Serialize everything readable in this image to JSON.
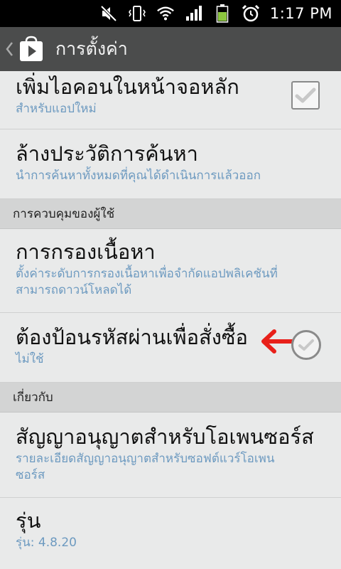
{
  "status_bar": {
    "time": "1:17 PM",
    "icons": [
      "mute-icon",
      "vibrate-icon",
      "wifi-icon",
      "signal-icon",
      "battery-icon",
      "alarm-icon"
    ]
  },
  "action_bar": {
    "title": "การตั้งค่า",
    "icon": "play-store-icon",
    "up_icon": "back-chevron-icon"
  },
  "items": [
    {
      "title": "เพิ่มไอคอนในหน้าจอหลัก",
      "summary": "สำหรับแอปใหม่",
      "control": "checkbox",
      "checked": true
    },
    {
      "title": "ล้างประวัติการค้นหา",
      "summary": "นำการค้นหาทั้งหมดที่คุณได้ดำเนินการแล้วออก"
    }
  ],
  "sections": [
    {
      "header": "การควบคุมของผู้ใช้",
      "items": [
        {
          "title": "การกรองเนื้อหา",
          "summary": "ตั้งค่าระดับการกรองเนื้อหาเพื่อจำกัดแอปพลิเคชันที่สามารถดาวน์โหลดได้"
        },
        {
          "title": "ต้องป้อนรหัสผ่านเพื่อสั่งซื้อ",
          "summary": "ไม่ใช้",
          "control": "check-circle",
          "annotation": "red-arrow-icon"
        }
      ]
    },
    {
      "header": "เกี่ยวกับ",
      "items": [
        {
          "title": "สัญญาอนุญาตสำหรับโอเพนซอร์ส",
          "summary": "รายละเอียดสัญญาอนุญาตสำหรับซอฟต์แวร์โอเพนซอร์ส"
        },
        {
          "title": "รุ่น",
          "summary": "รุ่น: 4.8.20"
        }
      ]
    }
  ],
  "colors": {
    "status_bar_bg": "#000000",
    "action_bar_bg": "#4b4c4c",
    "list_bg": "#e9eaea",
    "section_bg": "#d3d4d4",
    "summary_text": "#6d9ac0",
    "annotation_arrow": "#e8201a",
    "battery": "#8cc63f"
  }
}
